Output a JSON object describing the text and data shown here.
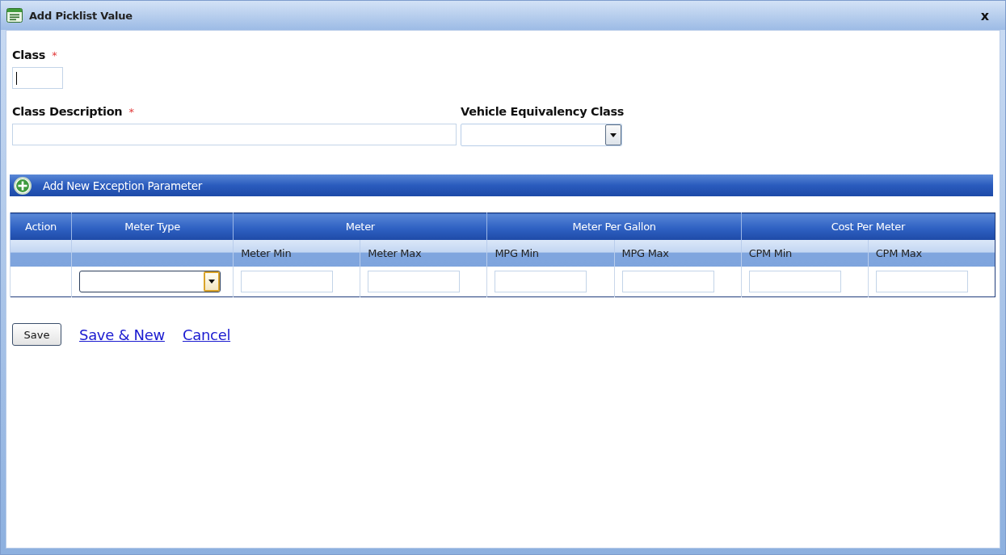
{
  "window": {
    "title": "Add Picklist Value",
    "close": "x"
  },
  "class_field": {
    "label": "Class",
    "required_mark": "*",
    "focused": true
  },
  "fields": [
    {
      "kind": "text",
      "label": "Class Description",
      "required_mark": "*"
    },
    {
      "kind": "dropdown",
      "label": "Vehicle Equivalency Class"
    }
  ],
  "section_bar": {
    "label": "Add New Exception Parameter"
  },
  "table": {
    "columns": [
      {
        "label": "Action"
      },
      {
        "label": "Meter Type"
      },
      {
        "label": "Meter",
        "subcolumns": [
          "Meter Min",
          "Meter Max"
        ]
      },
      {
        "label": "Meter Per Gallon",
        "subcolumns": [
          "MPG Min",
          "MPG Max"
        ]
      },
      {
        "label": "Cost Per Meter",
        "subcolumns": [
          "CPM Min",
          "CPM Max"
        ]
      }
    ],
    "row": [
      {
        "kind": "empty"
      },
      {
        "kind": "dropdown",
        "focused": true
      },
      {
        "kind": "input"
      },
      {
        "kind": "input"
      },
      {
        "kind": "input"
      },
      {
        "kind": "input"
      },
      {
        "kind": "input"
      },
      {
        "kind": "input"
      }
    ]
  },
  "actions": [
    {
      "kind": "button",
      "label": "Save"
    },
    {
      "kind": "link",
      "label": "Save & New"
    },
    {
      "kind": "link",
      "label": "Cancel"
    }
  ]
}
